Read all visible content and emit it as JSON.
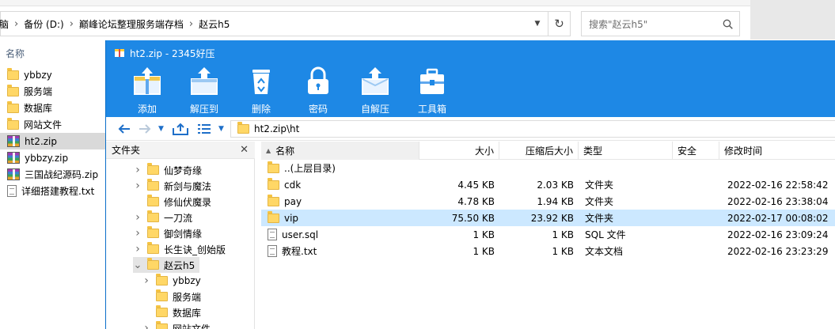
{
  "explorer": {
    "breadcrumb": [
      "脑",
      "备份 (D:)",
      "巅峰论坛整理服务端存档",
      "赵云h5"
    ],
    "search_placeholder": "搜索\"赵云h5\"",
    "column_name": "名称",
    "items": [
      {
        "name": "ybbzy",
        "icon": "folder-icon"
      },
      {
        "name": "服务端",
        "icon": "folder-icon"
      },
      {
        "name": "数据库",
        "icon": "folder-icon"
      },
      {
        "name": "网站文件",
        "icon": "folder-icon"
      },
      {
        "name": "ht2.zip",
        "icon": "zip-icon",
        "selected": true
      },
      {
        "name": "ybbzy.zip",
        "icon": "zip-icon"
      },
      {
        "name": "三国战纪源码.zip",
        "icon": "zip-icon"
      },
      {
        "name": "详细搭建教程.txt",
        "icon": "text-file-icon"
      }
    ]
  },
  "zip_window": {
    "title": "ht2.zip - 2345好压",
    "toolbar": [
      {
        "label": "添加",
        "icon": "add-icon"
      },
      {
        "label": "解压到",
        "icon": "extract-icon"
      },
      {
        "label": "删除",
        "icon": "recycle-bin-icon"
      },
      {
        "label": "密码",
        "icon": "lock-icon"
      },
      {
        "label": "自解压",
        "icon": "self-extract-icon"
      },
      {
        "label": "工具箱",
        "icon": "toolbox-icon"
      }
    ],
    "path": "ht2.zip\\ht",
    "folder_pane": {
      "title": "文件夹",
      "items": [
        {
          "label": "仙梦奇缘",
          "level": 1,
          "expander": "collapsed"
        },
        {
          "label": "新剑与魔法",
          "level": 1,
          "expander": "collapsed"
        },
        {
          "label": "修仙伏魔录",
          "level": 1,
          "expander": "none"
        },
        {
          "label": "一刀流",
          "level": 1,
          "expander": "collapsed"
        },
        {
          "label": "御剑情缘",
          "level": 1,
          "expander": "collapsed"
        },
        {
          "label": "长生诀_创始版",
          "level": 1,
          "expander": "collapsed"
        },
        {
          "label": "赵云h5",
          "level": 1,
          "expander": "expanded",
          "selected": true
        },
        {
          "label": "ybbzy",
          "level": 2,
          "expander": "collapsed"
        },
        {
          "label": "服务端",
          "level": 2,
          "expander": "none"
        },
        {
          "label": "数据库",
          "level": 2,
          "expander": "none"
        },
        {
          "label": "网站文件",
          "level": 2,
          "expander": "collapsed"
        }
      ]
    },
    "columns": [
      "名称",
      "大小",
      "压缩后大小",
      "类型",
      "安全",
      "修改时间"
    ],
    "files": [
      {
        "name": "..(上层目录)",
        "size": "",
        "packed": "",
        "type": "",
        "safety": "",
        "modified": "",
        "icon": "folder-icon"
      },
      {
        "name": "cdk",
        "size": "4.45 KB",
        "packed": "2.03 KB",
        "type": "文件夹",
        "safety": "",
        "modified": "2022-02-16 22:58:42",
        "icon": "folder-icon"
      },
      {
        "name": "pay",
        "size": "4.78 KB",
        "packed": "1.94 KB",
        "type": "文件夹",
        "safety": "",
        "modified": "2022-02-16 23:38:04",
        "icon": "folder-icon"
      },
      {
        "name": "vip",
        "size": "75.50 KB",
        "packed": "23.92 KB",
        "type": "文件夹",
        "safety": "",
        "modified": "2022-02-17 00:08:02",
        "icon": "folder-icon",
        "selected": true
      },
      {
        "name": "user.sql",
        "size": "1 KB",
        "packed": "1 KB",
        "type": "SQL 文件",
        "safety": "",
        "modified": "2022-02-16 23:09:24",
        "icon": "file-icon"
      },
      {
        "name": "教程.txt",
        "size": "1 KB",
        "packed": "1 KB",
        "type": "文本文档",
        "safety": "",
        "modified": "2022-02-16 23:23:29",
        "icon": "text-file-icon"
      }
    ]
  },
  "colors": {
    "title_blue": "#1e88e5",
    "selection": "#cce8ff",
    "folder": "#ffd766"
  }
}
